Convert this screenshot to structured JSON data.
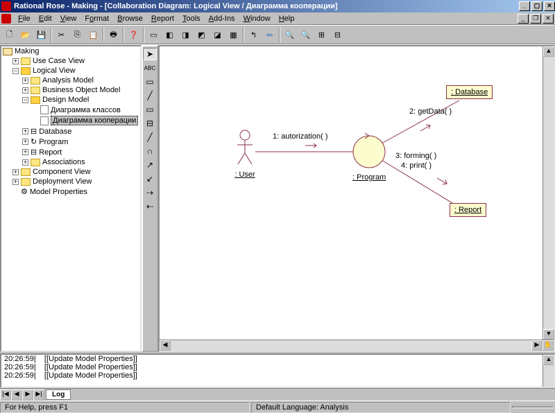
{
  "title": "Rational Rose - Making - [Collaboration Diagram: Logical View / Диаграмма кооперации]",
  "menu": {
    "file": "File",
    "edit": "Edit",
    "view": "View",
    "format": "Format",
    "browse": "Browse",
    "report": "Report",
    "tools": "Tools",
    "addins": "Add-Ins",
    "window": "Window",
    "help": "Help"
  },
  "tree": {
    "root": "Making",
    "usecase": "Use Case View",
    "logical": "Logical View",
    "analysis": "Analysis Model",
    "bom": "Business Object Model",
    "design": "Design Model",
    "diag1": "Диаграмма классов",
    "diag2": "Диаграмма кооперации",
    "database": "Database",
    "program": "Program",
    "report": "Report",
    "assoc": "Associations",
    "component": "Component View",
    "deployment": "Deployment View",
    "modelprops": "Model Properties"
  },
  "diagram": {
    "user": ": User",
    "program": ": Program",
    "database": ": Database",
    "report": ": Report",
    "msg1": "1: autorization( )",
    "msg2": "2: getData( )",
    "msg3": "3: forming( )",
    "msg4": "4: print( )"
  },
  "log": {
    "l1": "20:26:59|    [[Update Model Properties]]",
    "l2": "20:26:59|    [[Update Model Properties]]",
    "l3": "20:26:59|    [[Update Model Properties]]",
    "tab": "Log"
  },
  "status": {
    "help": "For Help, press F1",
    "lang": "Default Language: Analysis"
  }
}
